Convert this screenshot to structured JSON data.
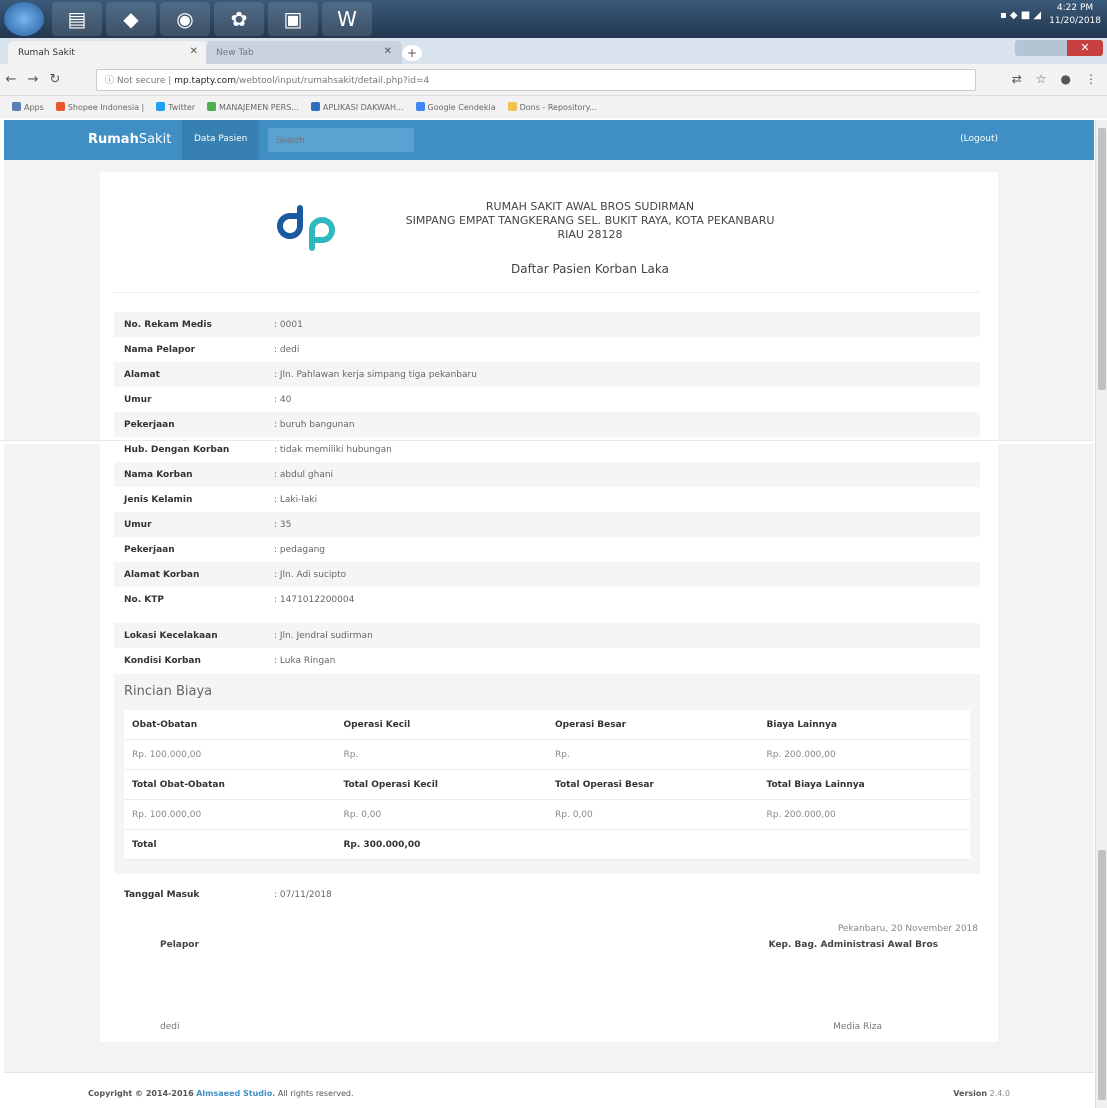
{
  "taskbar": {
    "clock_time": "4:22 PM",
    "clock_date": "11/20/2018"
  },
  "browser": {
    "tabs": [
      {
        "label": "Rumah Sakit"
      },
      {
        "label": "New Tab"
      }
    ],
    "url_prefix": "Not secure",
    "url_host": "mp.tapty.com",
    "url_path": "/webtool/input/rumahsakit/detail.php?id=4",
    "bookmarks": [
      "Apps",
      "Shopee Indonesia |",
      "Twitter",
      "MANAJEMEN PERS...",
      "APLIKASI DAKWAH...",
      "Google Cendekia",
      "Dons - Repository..."
    ]
  },
  "navbar": {
    "brand_bold": "Rumah",
    "brand_rest": "Sakit",
    "link": "Data Pasien",
    "search_placeholder": "Search",
    "logout": "(Logout)"
  },
  "header": {
    "hospital_name": "RUMAH SAKIT AWAL BROS SUDIRMAN",
    "address_line": "SIMPANG EMPAT TANGKERANG SEL. BUKIT RAYA, KOTA PEKANBARU",
    "region": "RIAU 28128",
    "doc_title": "Daftar Pasien Korban Laka"
  },
  "fields": [
    {
      "label": "No. Rekam Medis",
      "value": ": 0001"
    },
    {
      "label": "Nama Pelapor",
      "value": ": dedi"
    },
    {
      "label": "Alamat",
      "value": ": Jln. Pahlawan kerja simpang tiga pekanbaru"
    },
    {
      "label": "Umur",
      "value": ": 40"
    },
    {
      "label": "Pekerjaan",
      "value": ": buruh bangunan"
    },
    {
      "label": "Hub. Dengan Korban",
      "value": ": tidak memiliki hubungan"
    },
    {
      "label": "Nama Korban",
      "value": ": abdul ghani"
    },
    {
      "label": "Jenis Kelamin",
      "value": ": Laki-laki"
    },
    {
      "label": "Umur",
      "value": ": 35"
    },
    {
      "label": "Pekerjaan",
      "value": ": pedagang"
    },
    {
      "label": "Alamat Korban",
      "value": ": Jln. Adi sucipto"
    },
    {
      "label": "No. KTP",
      "value": ": 1471012200004"
    }
  ],
  "fields2": [
    {
      "label": "Lokasi Kecelakaan",
      "value": ": Jln. Jendral sudirman"
    },
    {
      "label": "Kondisi Korban",
      "value": ": Luka Ringan"
    }
  ],
  "rincian": {
    "title": "Rincian Biaya",
    "head1": [
      "Obat-Obatan",
      "Operasi Kecil",
      "Operasi Besar",
      "Biaya Lainnya"
    ],
    "vals1": [
      "Rp. 100.000,00",
      "Rp.",
      "Rp.",
      "Rp. 200.000,00"
    ],
    "head2": [
      "Total Obat-Obatan",
      "Total Operasi Kecil",
      "Total Operasi Besar",
      "Total Biaya Lainnya"
    ],
    "vals2": [
      "Rp. 100.000,00",
      "Rp. 0,00",
      "Rp. 0,00",
      "Rp. 200.000,00"
    ],
    "total_label": "Total",
    "total_value": "Rp. 300.000,00"
  },
  "tanggal": {
    "label": "Tanggal Masuk",
    "value": ": 07/11/2018"
  },
  "signature": {
    "place_date": "Pekanbaru, 20 November 2018",
    "left_title": "Pelapor",
    "right_title": "Kep. Bag. Administrasi Awal Bros",
    "left_name": "dedi",
    "right_name": "Media Riza"
  },
  "footer": {
    "copyright_prefix": "Copyright © 2014-2016",
    "company": "Almsaeed Studio.",
    "rights": "All rights reserved.",
    "version_label": "Version",
    "version_value": "2.4.0"
  },
  "colors": {
    "navbar": "#3f8fc4",
    "logo_dark": "#1a5aa0",
    "logo_light": "#2eb8c0"
  }
}
